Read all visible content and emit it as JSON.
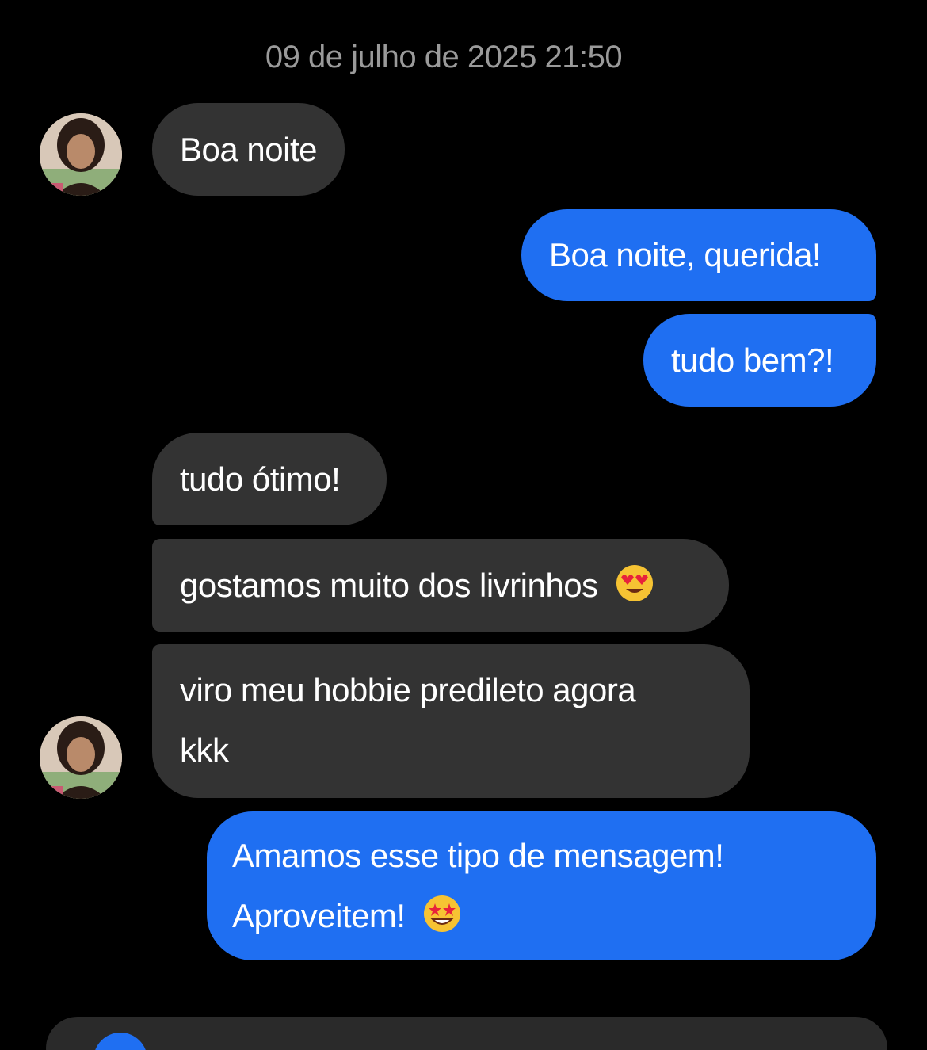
{
  "header": {
    "timestamp": "09 de julho de 2025 21:50"
  },
  "contact": {
    "avatar_icon": "profile-photo-avatar"
  },
  "messages": [
    {
      "direction": "incoming",
      "text": "Boa noite"
    },
    {
      "direction": "outgoing",
      "text": "Boa noite, querida!"
    },
    {
      "direction": "outgoing",
      "text": "tudo bem?!"
    },
    {
      "direction": "incoming",
      "text": "tudo ótimo!"
    },
    {
      "direction": "incoming",
      "text": "gostamos muito dos livrinhos",
      "emoji": "heart-eyes-emoji"
    },
    {
      "direction": "incoming",
      "line1": "viro meu hobbie predileto agora",
      "line2": "kkk"
    },
    {
      "direction": "outgoing",
      "line1": "Amamos esse tipo de mensagem!",
      "line2": "Aproveitem!",
      "emoji": "star-struck-emoji"
    }
  ],
  "colors": {
    "background": "#000000",
    "incoming_bubble": "#333333",
    "outgoing_bubble": "#1f6ff2",
    "timestamp_text": "#9a9a9a"
  }
}
